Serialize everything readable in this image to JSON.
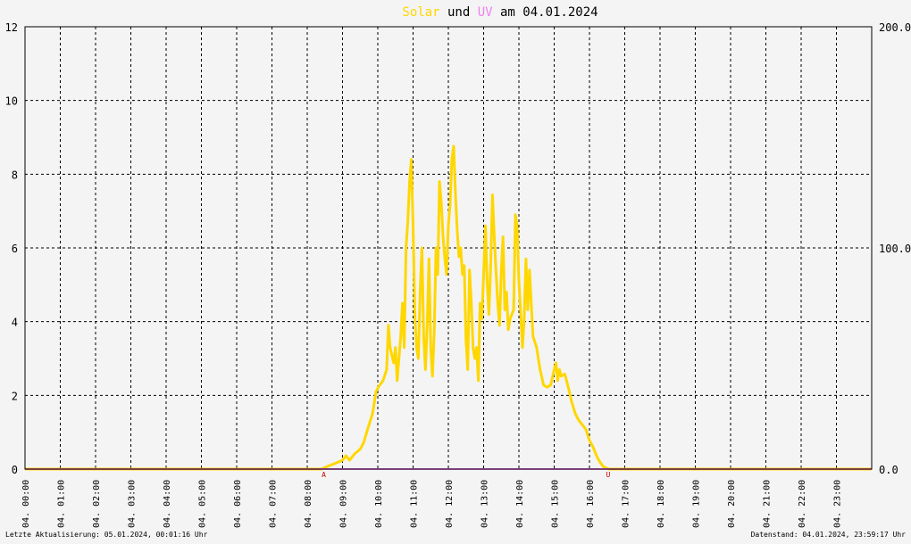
{
  "chart_data": {
    "type": "line",
    "title_parts": [
      {
        "text": "Solar",
        "color": "#ffd700"
      },
      {
        "text": " und ",
        "color": "#000000"
      },
      {
        "text": "UV",
        "color": "#ee82ee"
      },
      {
        "text": " am 04.01.2024",
        "color": "#000000"
      }
    ],
    "y_left": {
      "min": 0,
      "max": 12,
      "ticks": [
        "0",
        "2",
        "4",
        "6",
        "8",
        "10",
        "12"
      ]
    },
    "y_right": {
      "min": 0,
      "max": 200,
      "ticks": [
        "0.0",
        "100.0",
        "200.0"
      ]
    },
    "x": {
      "min": 0,
      "max": 24,
      "unit": "hours",
      "tick_labels": [
        "04. 00:00",
        "04. 01:00",
        "04. 02:00",
        "04. 03:00",
        "04. 04:00",
        "04. 05:00",
        "04. 06:00",
        "04. 07:00",
        "04. 08:00",
        "04. 09:00",
        "04. 10:00",
        "04. 11:00",
        "04. 12:00",
        "04. 13:00",
        "04. 14:00",
        "04. 15:00",
        "04. 16:00",
        "04. 17:00",
        "04. 18:00",
        "04. 19:00",
        "04. 20:00",
        "04. 21:00",
        "04. 22:00",
        "04. 23:00"
      ]
    },
    "grid": true,
    "markers": [
      {
        "label": "A",
        "x": 8.47
      },
      {
        "label": "U",
        "x": 16.53
      }
    ],
    "series": [
      {
        "color": "#ffd700",
        "axis": "right",
        "points": [
          [
            0,
            0
          ],
          [
            8.4,
            0
          ],
          [
            8.55,
            1
          ],
          [
            8.7,
            2
          ],
          [
            8.85,
            3
          ],
          [
            9.0,
            4
          ],
          [
            9.1,
            6
          ],
          [
            9.2,
            4
          ],
          [
            9.35,
            7
          ],
          [
            9.5,
            9
          ],
          [
            9.6,
            12
          ],
          [
            9.75,
            20
          ],
          [
            9.85,
            25
          ],
          [
            9.95,
            35
          ],
          [
            10.05,
            38
          ],
          [
            10.15,
            40
          ],
          [
            10.25,
            45
          ],
          [
            10.3,
            65
          ],
          [
            10.35,
            55
          ],
          [
            10.45,
            48
          ],
          [
            10.5,
            55
          ],
          [
            10.55,
            40
          ],
          [
            10.65,
            60
          ],
          [
            10.7,
            75
          ],
          [
            10.75,
            55
          ],
          [
            10.8,
            100
          ],
          [
            10.85,
            112
          ],
          [
            10.9,
            130
          ],
          [
            10.95,
            140
          ],
          [
            11.0,
            110
          ],
          [
            11.05,
            70
          ],
          [
            11.1,
            55
          ],
          [
            11.15,
            50
          ],
          [
            11.2,
            80
          ],
          [
            11.25,
            100
          ],
          [
            11.3,
            60
          ],
          [
            11.35,
            45
          ],
          [
            11.4,
            65
          ],
          [
            11.45,
            95
          ],
          [
            11.5,
            55
          ],
          [
            11.55,
            42
          ],
          [
            11.6,
            62
          ],
          [
            11.65,
            100
          ],
          [
            11.7,
            88
          ],
          [
            11.75,
            130
          ],
          [
            11.8,
            120
          ],
          [
            11.85,
            105
          ],
          [
            11.9,
            95
          ],
          [
            11.95,
            88
          ],
          [
            12.0,
            110
          ],
          [
            12.05,
            120
          ],
          [
            12.1,
            140
          ],
          [
            12.15,
            146
          ],
          [
            12.2,
            125
          ],
          [
            12.25,
            108
          ],
          [
            12.3,
            96
          ],
          [
            12.35,
            100
          ],
          [
            12.4,
            88
          ],
          [
            12.45,
            92
          ],
          [
            12.5,
            58
          ],
          [
            12.55,
            45
          ],
          [
            12.6,
            90
          ],
          [
            12.65,
            75
          ],
          [
            12.7,
            55
          ],
          [
            12.75,
            50
          ],
          [
            12.8,
            55
          ],
          [
            12.85,
            40
          ],
          [
            12.9,
            75
          ],
          [
            12.95,
            68
          ],
          [
            13.0,
            88
          ],
          [
            13.05,
            110
          ],
          [
            13.1,
            85
          ],
          [
            13.15,
            70
          ],
          [
            13.2,
            92
          ],
          [
            13.25,
            124
          ],
          [
            13.3,
            105
          ],
          [
            13.35,
            90
          ],
          [
            13.4,
            75
          ],
          [
            13.45,
            65
          ],
          [
            13.5,
            90
          ],
          [
            13.55,
            105
          ],
          [
            13.6,
            72
          ],
          [
            13.65,
            80
          ],
          [
            13.7,
            63
          ],
          [
            13.75,
            68
          ],
          [
            13.8,
            70
          ],
          [
            13.85,
            72
          ],
          [
            13.9,
            115
          ],
          [
            13.95,
            110
          ],
          [
            14.0,
            85
          ],
          [
            14.05,
            70
          ],
          [
            14.1,
            55
          ],
          [
            14.15,
            68
          ],
          [
            14.2,
            95
          ],
          [
            14.25,
            72
          ],
          [
            14.3,
            90
          ],
          [
            14.35,
            75
          ],
          [
            14.4,
            60
          ],
          [
            14.5,
            55
          ],
          [
            14.6,
            45
          ],
          [
            14.7,
            38
          ],
          [
            14.8,
            37
          ],
          [
            14.9,
            38
          ],
          [
            15.0,
            45
          ],
          [
            15.05,
            48
          ],
          [
            15.1,
            40
          ],
          [
            15.15,
            45
          ],
          [
            15.2,
            42
          ],
          [
            15.3,
            43
          ],
          [
            15.4,
            37
          ],
          [
            15.5,
            30
          ],
          [
            15.6,
            25
          ],
          [
            15.7,
            22
          ],
          [
            15.8,
            20
          ],
          [
            15.9,
            18
          ],
          [
            16.0,
            13
          ],
          [
            16.1,
            10
          ],
          [
            16.2,
            6
          ],
          [
            16.3,
            3
          ],
          [
            16.4,
            1
          ],
          [
            16.55,
            0
          ],
          [
            24,
            0
          ]
        ]
      },
      {
        "color": "#ee82ee",
        "axis": "left",
        "points": [
          [
            0,
            0
          ],
          [
            24,
            0
          ]
        ]
      },
      {
        "color": "#fa8072",
        "axis": "left",
        "points": [
          [
            0,
            0
          ],
          [
            8.4,
            0
          ]
        ]
      },
      {
        "color": "#fa8072",
        "axis": "left",
        "points": [
          [
            16.55,
            0
          ],
          [
            24,
            0
          ]
        ]
      }
    ]
  },
  "footer": {
    "left": "Letzte Aktualisierung: 05.01.2024, 00:01:16 Uhr",
    "right": "Datenstand: 04.01.2024, 23:59:17 Uhr"
  }
}
